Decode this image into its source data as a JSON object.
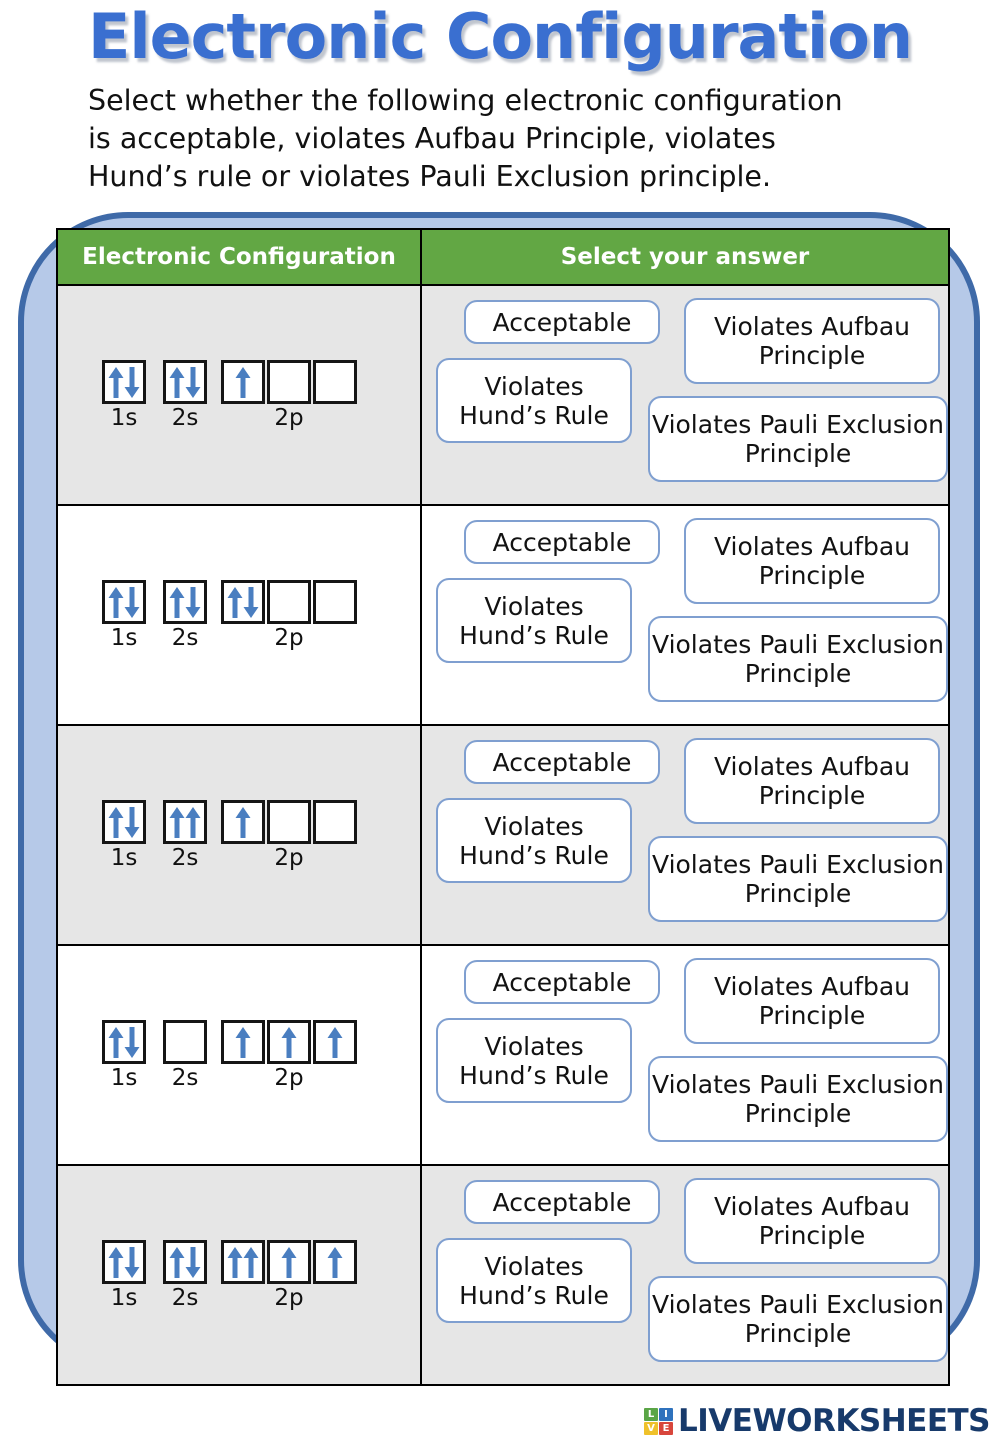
{
  "page": {
    "title": "Electronic Configuration",
    "instructions": [
      "Select whether the following electronic configuration",
      "is acceptable, violates Aufbau Principle, violates",
      "Hund’s rule or violates Pauli Exclusion principle."
    ]
  },
  "colors": {
    "title": "#3a6fd0",
    "header_green": "#62a744",
    "frame_blue": "#3f6aa8",
    "frame_fill": "#b6c9e8",
    "arrow_blue": "#4a7ec0",
    "row_shade": "#e6e6e6",
    "button_border": "#7f9fd0",
    "logo_navy": "#173a6b"
  },
  "table": {
    "headers": {
      "configuration": "Electronic Configuration",
      "answer": "Select your answer"
    },
    "orbital_labels": {
      "s1": "1s",
      "s2": "2s",
      "p2": "2p"
    },
    "answer_options": {
      "acceptable": "Acceptable",
      "hund": "Violates Hund’s Rule",
      "aufbau": "Violates Aufbau Principle",
      "pauli": "Violates Pauli Exclusion Principle"
    },
    "rows": [
      {
        "index": 1,
        "shaded": true,
        "orbitals": {
          "1s": [
            "up-down"
          ],
          "2s": [
            "up-down"
          ],
          "2p": [
            "up",
            "empty",
            "empty"
          ]
        }
      },
      {
        "index": 2,
        "shaded": false,
        "orbitals": {
          "1s": [
            "up-down"
          ],
          "2s": [
            "up-down"
          ],
          "2p": [
            "up-down",
            "empty",
            "empty"
          ]
        }
      },
      {
        "index": 3,
        "shaded": true,
        "orbitals": {
          "1s": [
            "up-down"
          ],
          "2s": [
            "up-up"
          ],
          "2p": [
            "up",
            "empty",
            "empty"
          ]
        }
      },
      {
        "index": 4,
        "shaded": false,
        "orbitals": {
          "1s": [
            "up-down"
          ],
          "2s": [
            "empty"
          ],
          "2p": [
            "up",
            "up",
            "up"
          ]
        }
      },
      {
        "index": 5,
        "shaded": true,
        "orbitals": {
          "1s": [
            "up-down"
          ],
          "2s": [
            "up-down"
          ],
          "2p": [
            "up-up",
            "up",
            "up"
          ]
        }
      }
    ]
  },
  "footer": {
    "logo_letters": [
      "L",
      "I",
      "V",
      "E"
    ],
    "brand": "LIVEWORKSHEETS"
  }
}
